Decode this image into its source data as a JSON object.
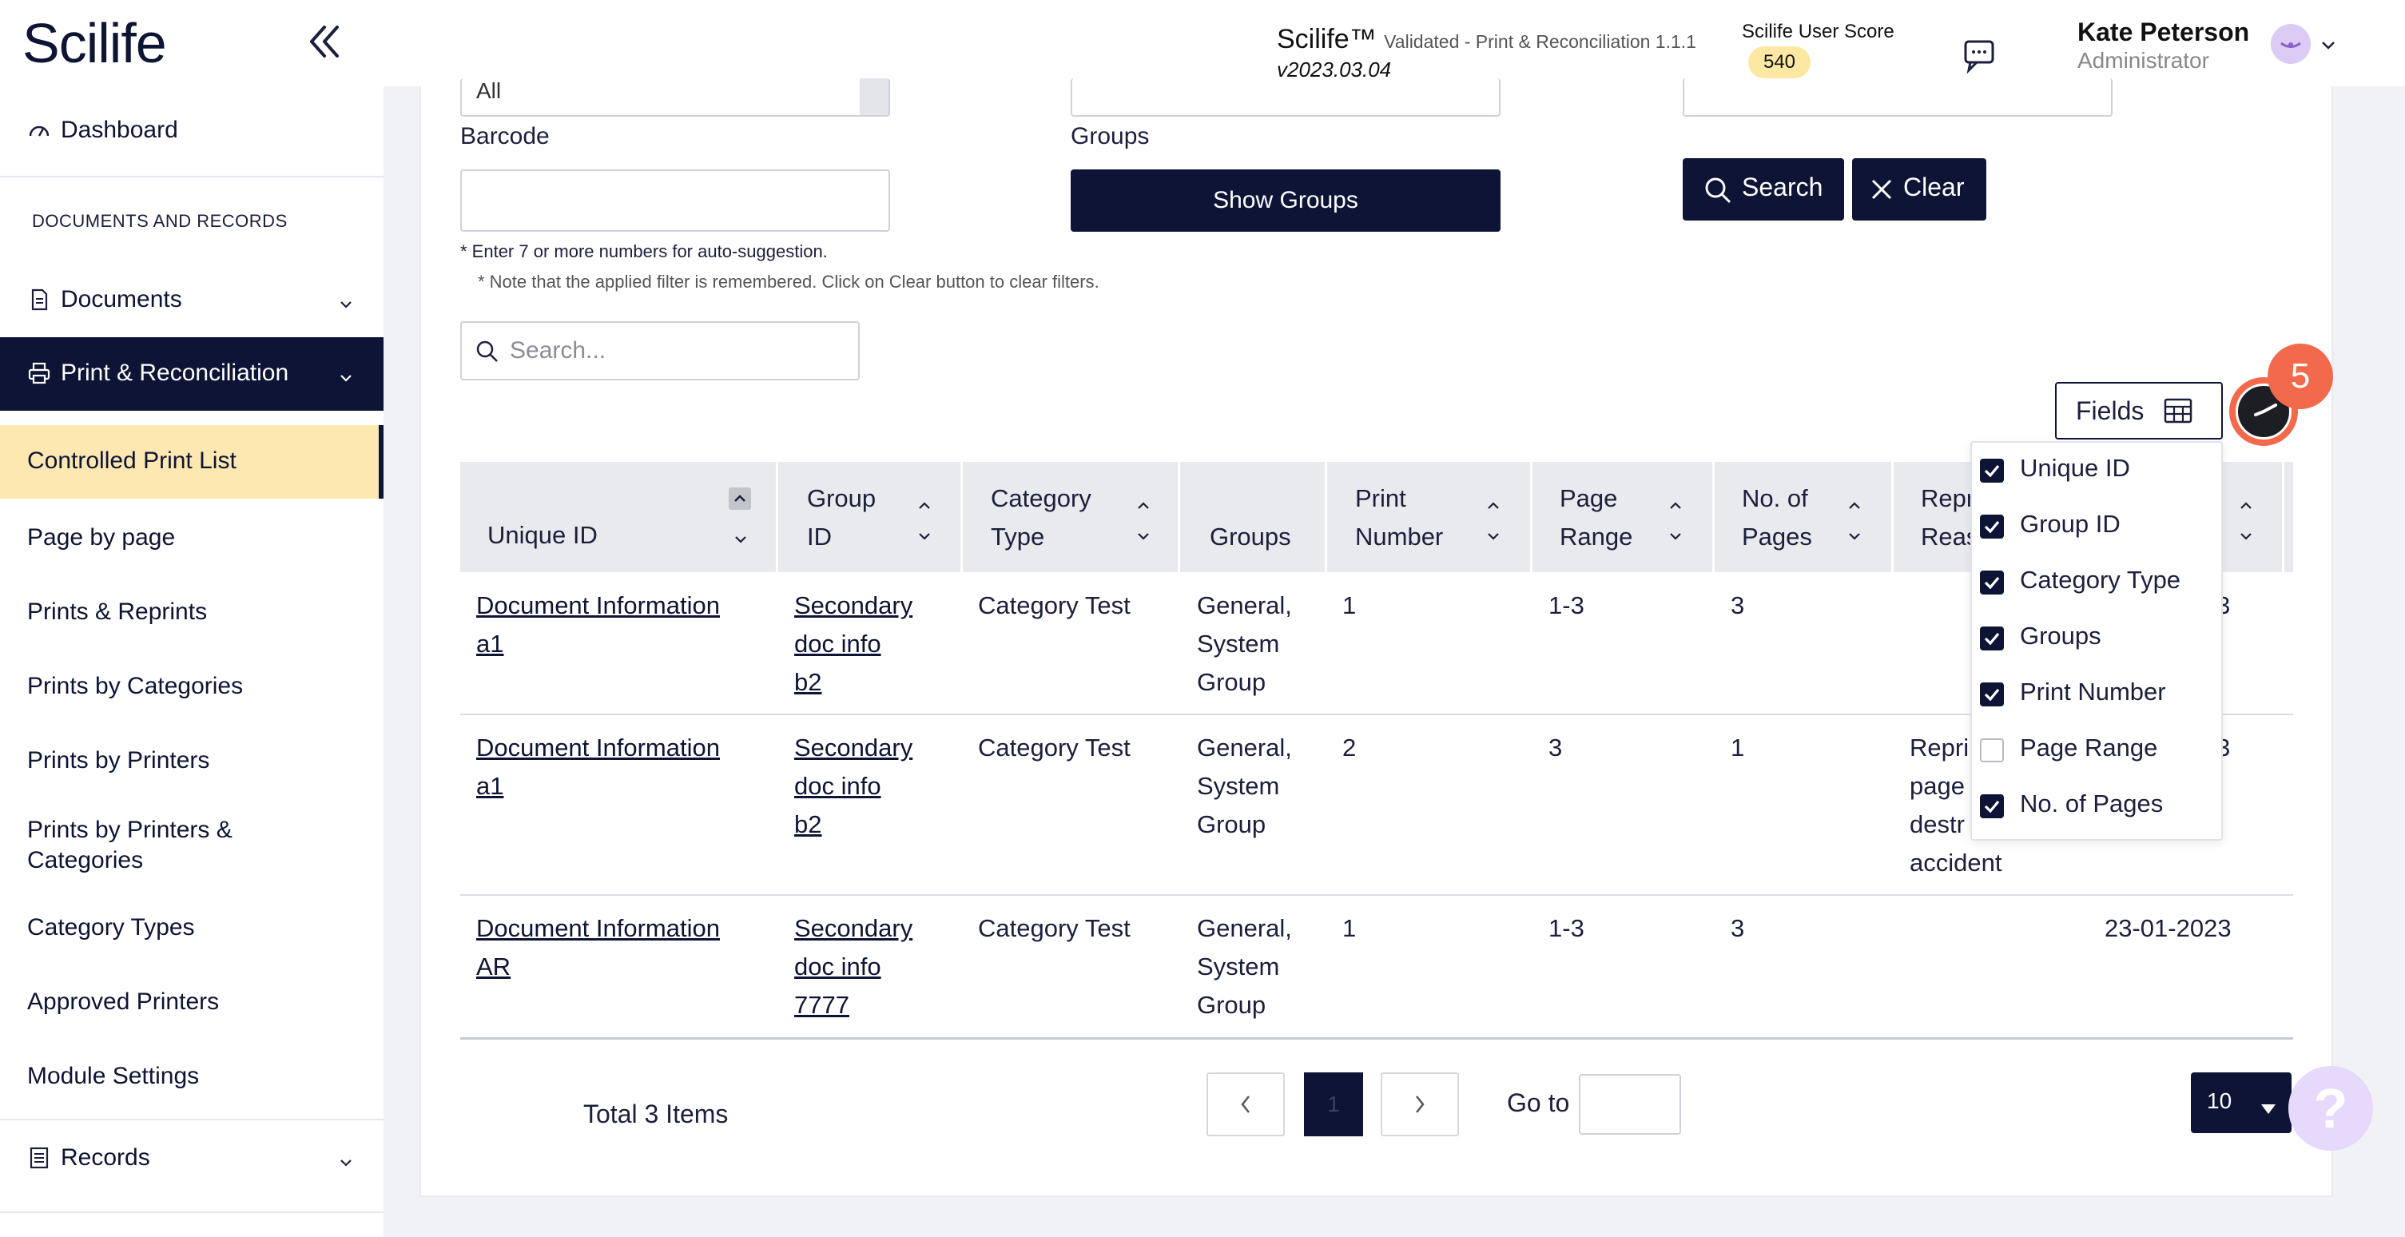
{
  "header": {
    "logo": "Scilife",
    "product_name": "Scilife™",
    "product_sub": "Validated - Print & Reconciliation 1.1.1",
    "version": "v2023.03.04",
    "score_label": "Scilife User Score",
    "score_value": "540",
    "user_name": "Kate Peterson",
    "user_role": "Administrator"
  },
  "sidebar": {
    "dashboard": "Dashboard",
    "section": "DOCUMENTS AND RECORDS",
    "documents": "Documents",
    "print_reconciliation": "Print & Reconciliation",
    "items": [
      "Controlled Print List",
      "Page by page",
      "Prints & Reprints",
      "Prints by Categories",
      "Prints by Printers",
      "Prints by Printers & Categories",
      "Category Types",
      "Approved Printers",
      "Module Settings"
    ],
    "records": "Records"
  },
  "filters": {
    "top_select_value": "All",
    "barcode_label": "Barcode",
    "groups_label": "Groups",
    "show_groups": "Show Groups",
    "search_button": "Search",
    "clear_button": "Clear",
    "note_autosuggest": "* Enter 7 or more numbers for auto-suggestion.",
    "note_remembered": "* Note that the applied filter is remembered. Click on Clear button to clear filters.",
    "search_placeholder": "Search..."
  },
  "fields": {
    "button_label": "Fields",
    "badge": "5",
    "options": [
      {
        "label": "Unique ID",
        "checked": true
      },
      {
        "label": "Group ID",
        "checked": true
      },
      {
        "label": "Category Type",
        "checked": true
      },
      {
        "label": "Groups",
        "checked": true
      },
      {
        "label": "Print Number",
        "checked": true
      },
      {
        "label": "Page Range",
        "checked": false
      },
      {
        "label": "No. of Pages",
        "checked": true
      }
    ]
  },
  "table": {
    "headers": {
      "unique_id": "Unique ID",
      "group_id_1": "Group",
      "group_id_2": "ID",
      "category_1": "Category",
      "category_2": "Type",
      "groups": "Groups",
      "print_1": "Print",
      "print_2": "Number",
      "range_1": "Page",
      "range_2": "Range",
      "pages_1": "No. of",
      "pages_2": "Pages",
      "reason_1": "Repri",
      "reason_2": "Reas"
    },
    "rows": [
      {
        "uid_1": "Document Information",
        "uid_2": "a1",
        "gid_1": "Secondary",
        "gid_2": "doc info",
        "gid_3": "b2",
        "category": "Category Test",
        "groups_1": "General,",
        "groups_2": "System",
        "groups_3": "Group",
        "print_number": "1",
        "page_range": "1-3",
        "pages": "3",
        "reason_1": "",
        "reason_2": "",
        "reason_3": "",
        "reason_4": "",
        "date": "3"
      },
      {
        "uid_1": "Document Information",
        "uid_2": "a1",
        "gid_1": "Secondary",
        "gid_2": "doc info",
        "gid_3": "b2",
        "category": "Category Test",
        "groups_1": "General,",
        "groups_2": "System",
        "groups_3": "Group",
        "print_number": "2",
        "page_range": "3",
        "pages": "1",
        "reason_1": "Repri",
        "reason_2": "page",
        "reason_3": "destr",
        "reason_4": "accident",
        "date": "3"
      },
      {
        "uid_1": "Document Information",
        "uid_2": "AR",
        "gid_1": "Secondary",
        "gid_2": "doc info",
        "gid_3": "7777",
        "category": "Category Test",
        "groups_1": "General,",
        "groups_2": "System",
        "groups_3": "Group",
        "print_number": "1",
        "page_range": "1-3",
        "pages": "3",
        "reason_1": "",
        "reason_2": "",
        "reason_3": "",
        "reason_4": "",
        "date": "23-01-2023"
      }
    ]
  },
  "pagination": {
    "total": "Total 3 Items",
    "current_page": "1",
    "goto_label": "Go to",
    "page_size": "10"
  },
  "help": "?",
  "colors": {
    "navy": "#0d1436",
    "highlight": "#fde8b1",
    "badge_orange": "#f26a4b",
    "score_badge": "#fde8a3"
  }
}
